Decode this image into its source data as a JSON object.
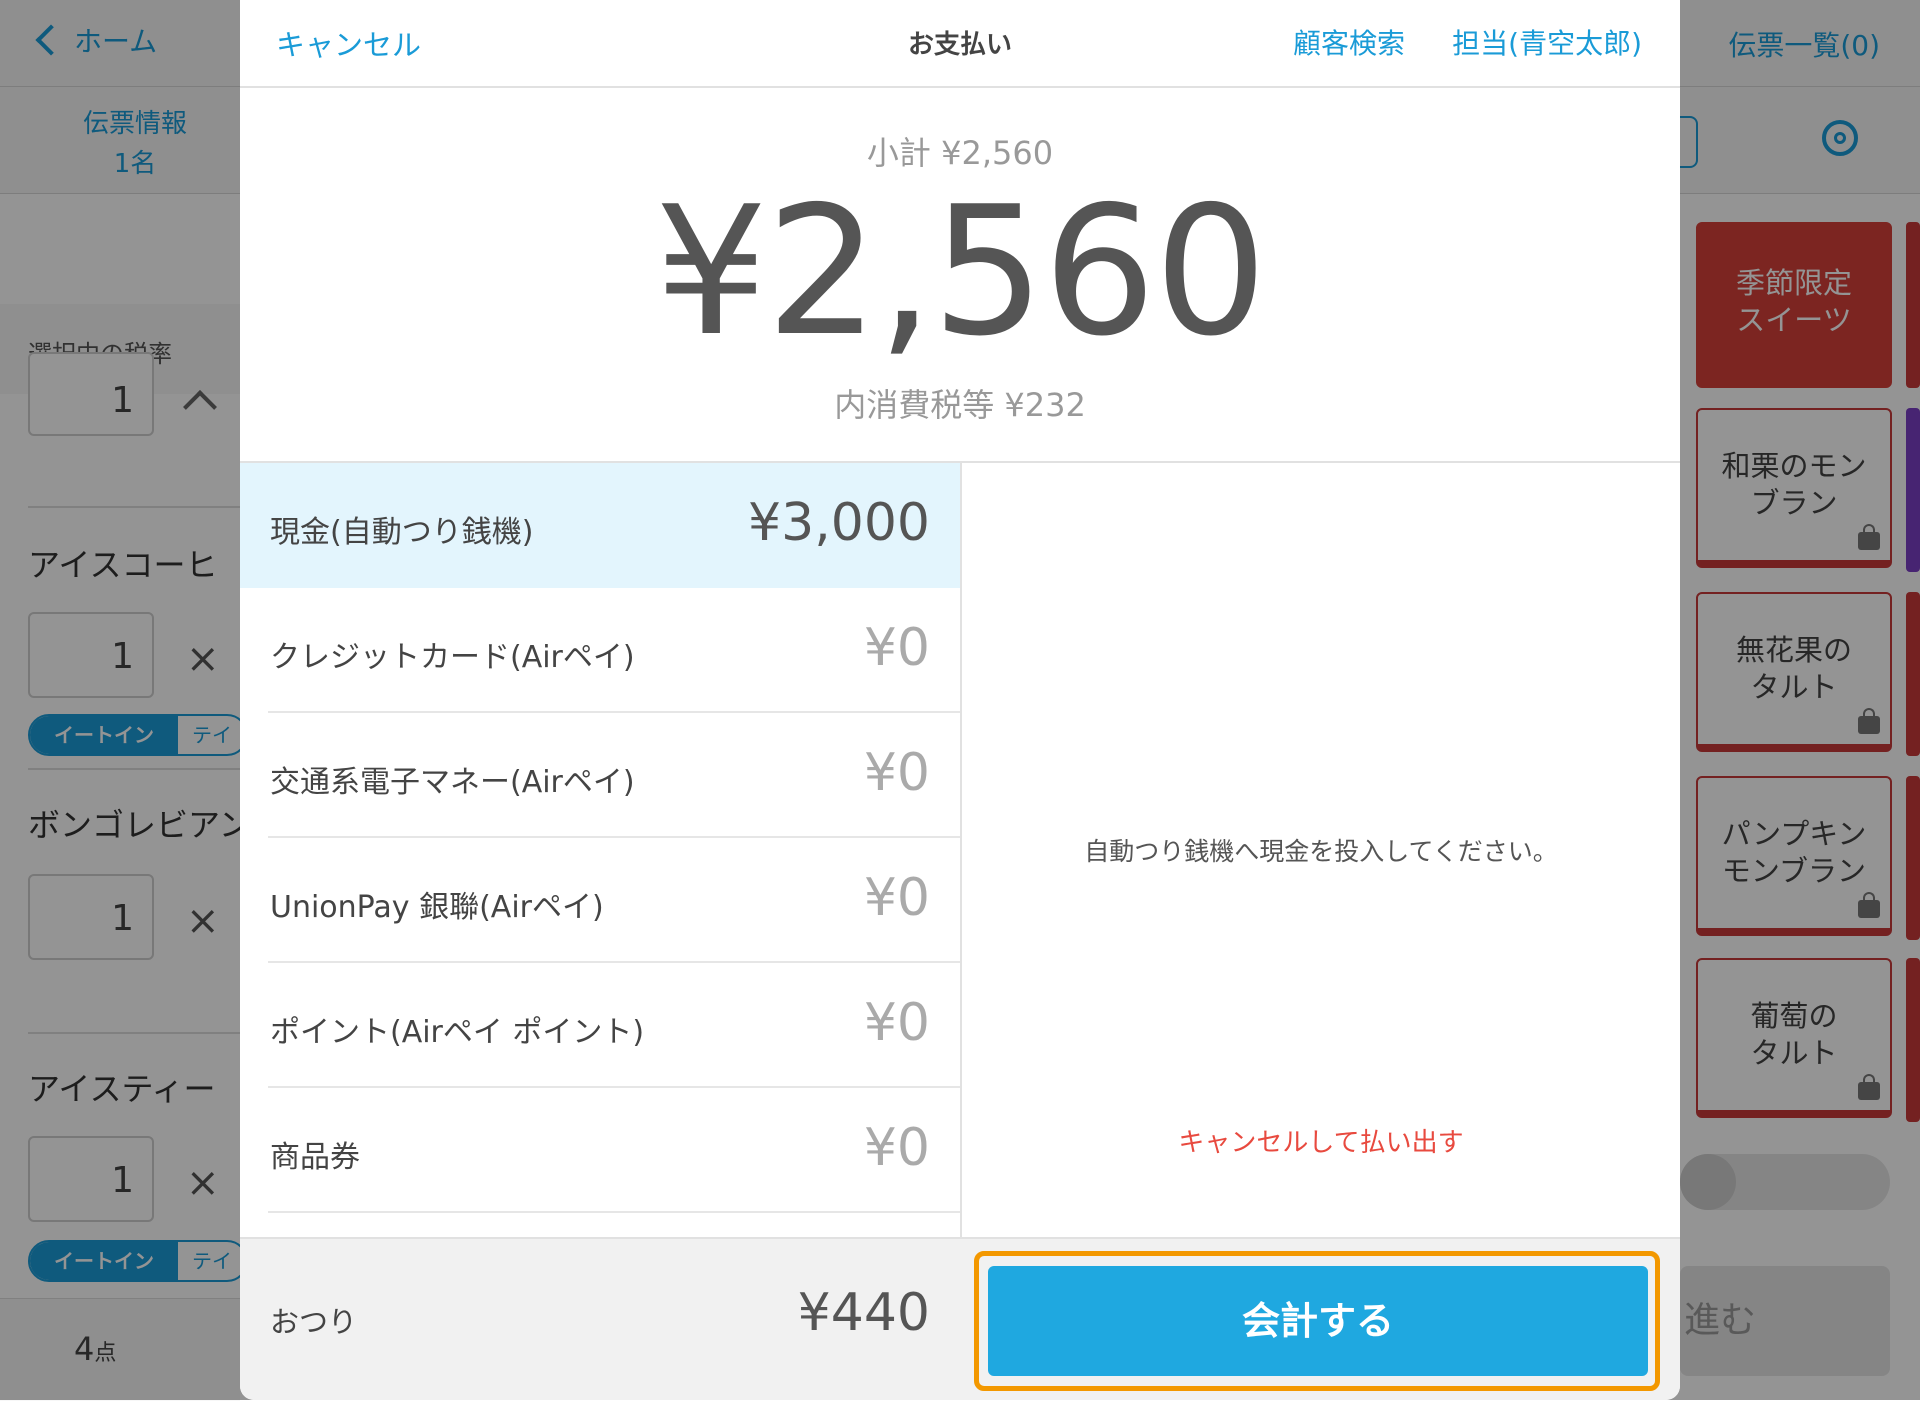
{
  "background": {
    "nav": {
      "home_label": "ホーム",
      "slip_list_label": "伝票一覧(0)"
    },
    "sub": {
      "slip_info_label": "伝票情報",
      "slip_info_count": "1名"
    },
    "tax_rate_label": "選択中の税率",
    "order_items": [
      {
        "name": "アイスコーヒ",
        "qty": "1",
        "seg_on": "イートイン",
        "seg_off": "テイ"
      },
      {
        "name": "ボンゴレビアン",
        "qty": "1"
      },
      {
        "name": "アイスティー",
        "qty": "1",
        "seg_on": "イートイン",
        "seg_off": "テイ"
      }
    ],
    "top_qty": "1",
    "item_count": "4",
    "item_count_unit": "点",
    "categories": [
      {
        "line1": "季節限定",
        "line2": "スイーツ"
      },
      {
        "line1": "和栗のモン",
        "line2": "ブラン"
      },
      {
        "line1": "無花果の",
        "line2": "タルト"
      },
      {
        "line1": "パンプキン",
        "line2": "モンブラン"
      },
      {
        "line1": "葡萄の",
        "line2": "タルト"
      }
    ],
    "next_label": "進む"
  },
  "modal": {
    "cancel_label": "キャンセル",
    "title": "お支払い",
    "customer_search_label": "顧客検索",
    "staff_label": "担当(青空太郎)",
    "subtotal_text": "小計 ¥2,560",
    "total_text": "¥2,560",
    "tax_text": "内消費税等 ¥232",
    "payment_methods": [
      {
        "label": "現金(自動つり銭機)",
        "amount": "¥3,000",
        "selected": true
      },
      {
        "label": "クレジットカード(Airペイ)",
        "amount": "¥0",
        "selected": false
      },
      {
        "label": "交通系電子マネー(Airペイ)",
        "amount": "¥0",
        "selected": false
      },
      {
        "label": "UnionPay 銀聯(Airペイ)",
        "amount": "¥0",
        "selected": false
      },
      {
        "label": "ポイント(Airペイ ポイント)",
        "amount": "¥0",
        "selected": false
      },
      {
        "label": "商品券",
        "amount": "¥0",
        "selected": false
      }
    ],
    "instruction_text": "自動つり銭機へ現金を投入してください。",
    "cancel_payout_label": "キャンセルして払い出す",
    "change_label": "おつり",
    "change_amount": "¥440",
    "checkout_label": "会計する"
  },
  "colors": {
    "accent": "#1a9bd7",
    "checkout_button": "#1fa8e0",
    "highlight_outline": "#f39800",
    "cancel_payout": "#e84a3f",
    "category_red": "#d6403a",
    "selected_row": "#e3f5fd"
  }
}
